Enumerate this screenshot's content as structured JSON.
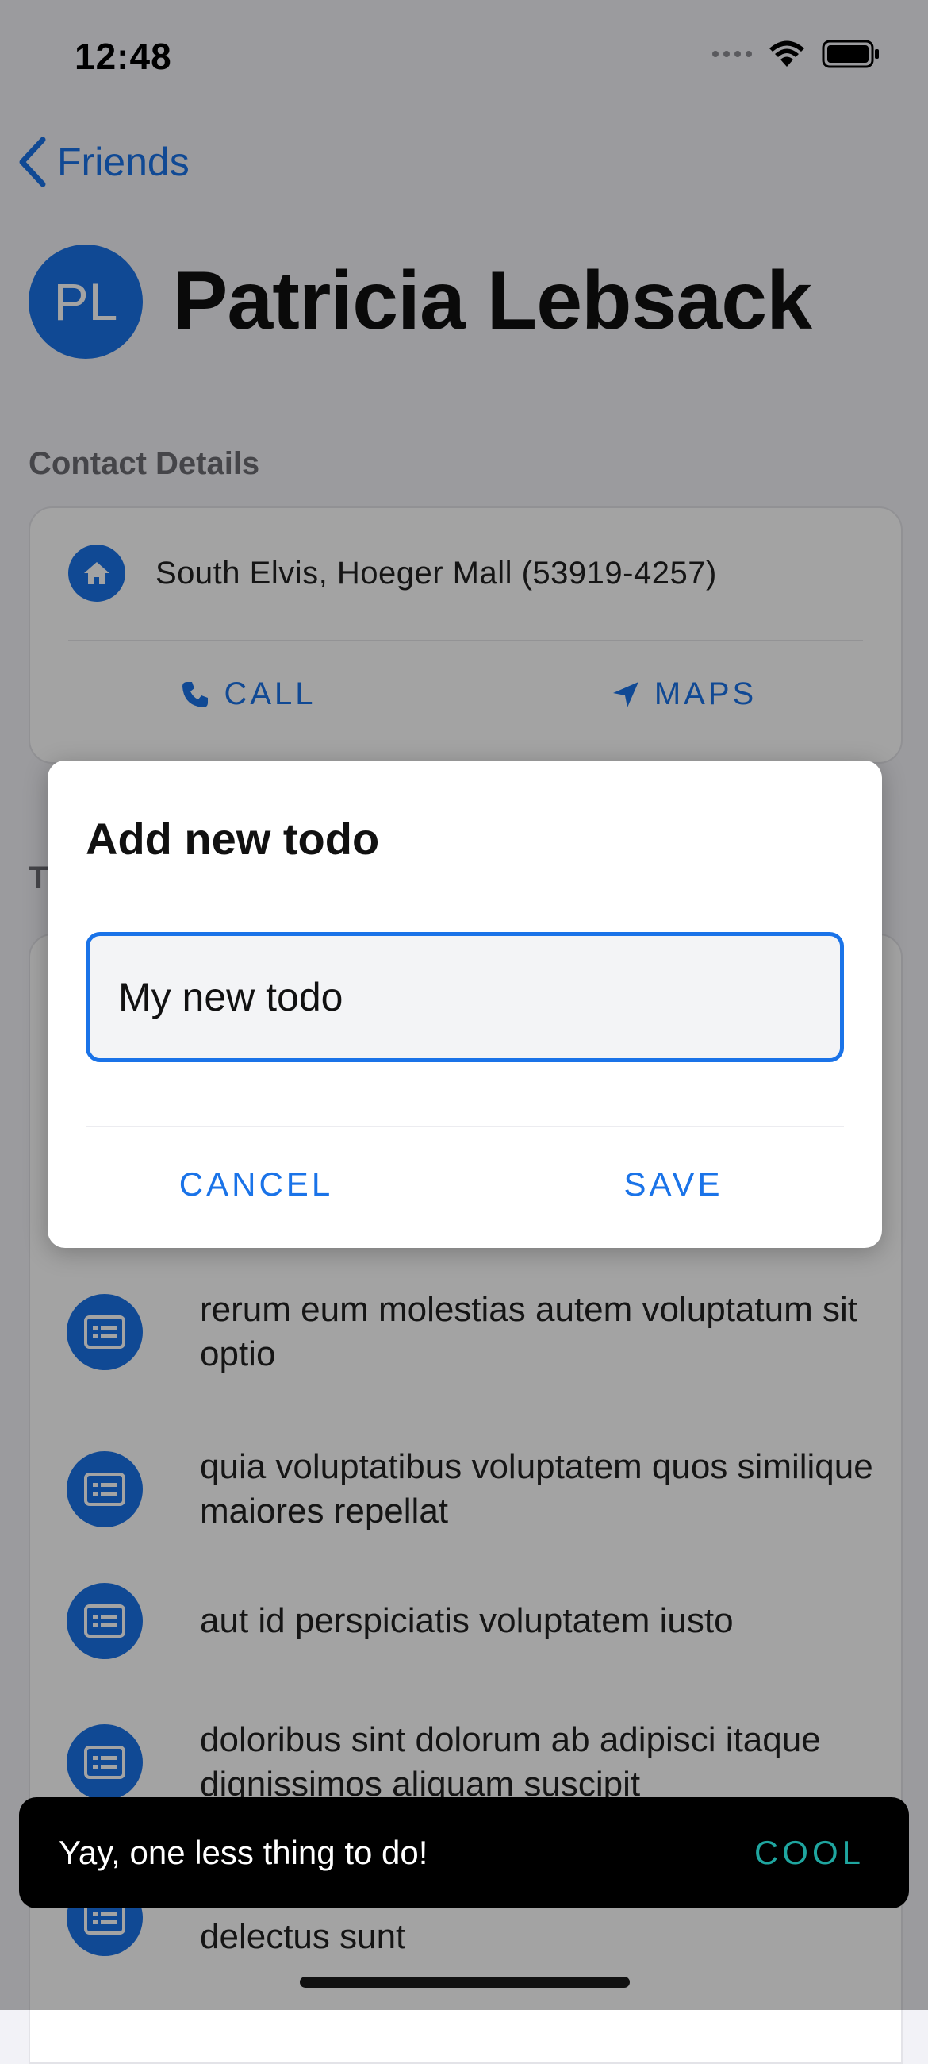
{
  "status": {
    "time": "12:48"
  },
  "nav": {
    "back_label": "Friends"
  },
  "person": {
    "initials": "PL",
    "name": "Patricia Lebsack"
  },
  "contact": {
    "section_title": "Contact Details",
    "address": "South Elvis, Hoeger Mall (53919-4257)",
    "call_label": "CALL",
    "maps_label": "MAPS"
  },
  "todos": {
    "section_title": "T",
    "items": [
      {
        "text": "rerum eum molestias autem voluptatum sit optio"
      },
      {
        "text": "quia voluptatibus voluptatem quos similique maiores repellat"
      },
      {
        "text": "aut id perspiciatis voluptatem iusto"
      },
      {
        "text": "doloribus sint dolorum ab adipisci itaque dignissimos aliquam suscipit"
      },
      {
        "text": "delectus sunt"
      }
    ]
  },
  "dialog": {
    "title": "Add new todo",
    "input_value": "My new todo",
    "cancel_label": "CANCEL",
    "save_label": "SAVE"
  },
  "snackbar": {
    "message": "Yay, one less thing to do!",
    "action_label": "COOL"
  },
  "colors": {
    "accent": "#1a73e8",
    "snackbar_action": "#1fa6a0"
  }
}
